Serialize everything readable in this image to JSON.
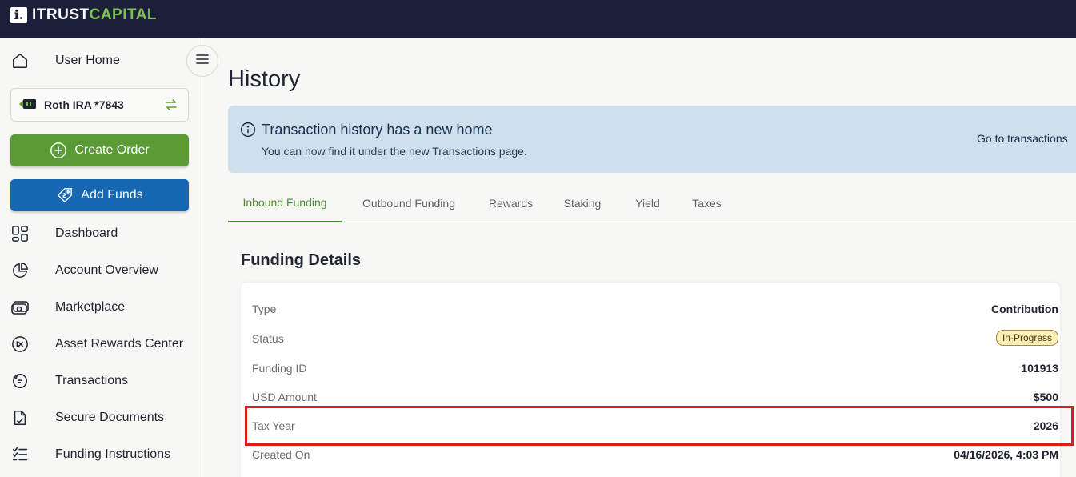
{
  "brand": {
    "logo_mark": "i.",
    "name_part1": "ITRUST",
    "name_part2": "CAPITAL"
  },
  "sidebar": {
    "user_home": "User Home",
    "account": "Roth IRA *7843",
    "create_order": "Create Order",
    "add_funds": "Add Funds",
    "items": [
      {
        "label": "Dashboard",
        "icon": "grid-icon"
      },
      {
        "label": "Account Overview",
        "icon": "pie-chart-icon"
      },
      {
        "label": "Marketplace",
        "icon": "cash-icon"
      },
      {
        "label": "Asset Rewards Center",
        "icon": "rewards-icon"
      },
      {
        "label": "Transactions",
        "icon": "transactions-icon"
      },
      {
        "label": "Secure Documents",
        "icon": "document-icon"
      },
      {
        "label": "Funding Instructions",
        "icon": "checklist-icon"
      }
    ]
  },
  "page": {
    "title": "History"
  },
  "banner": {
    "title": "Transaction history has a new home",
    "subtitle": "You can now find it under the new Transactions page.",
    "link": "Go to transactions"
  },
  "tabs": [
    {
      "label": "Inbound Funding",
      "active": true
    },
    {
      "label": "Outbound Funding",
      "active": false
    },
    {
      "label": "Rewards",
      "active": false
    },
    {
      "label": "Staking",
      "active": false
    },
    {
      "label": "Yield",
      "active": false
    },
    {
      "label": "Taxes",
      "active": false
    }
  ],
  "details": {
    "title": "Funding Details",
    "type_label": "Type",
    "type_value": "Contribution",
    "status_label": "Status",
    "status_value": "In-Progress",
    "funding_id_label": "Funding ID",
    "funding_id_value": "101913",
    "amount_label": "USD Amount",
    "amount_value": "$500",
    "tax_year_label": "Tax Year",
    "tax_year_value": "2026",
    "created_label": "Created On",
    "created_value": "04/16/2026, 4:03 PM"
  },
  "colors": {
    "topbar": "#1c1f3a",
    "brand_green": "#7fc24b",
    "create_order": "#5a9b35",
    "add_funds": "#1768b3",
    "banner_bg": "#cfe0ec",
    "active_tab": "#4f8c2d",
    "highlight": "#e01b1b"
  }
}
